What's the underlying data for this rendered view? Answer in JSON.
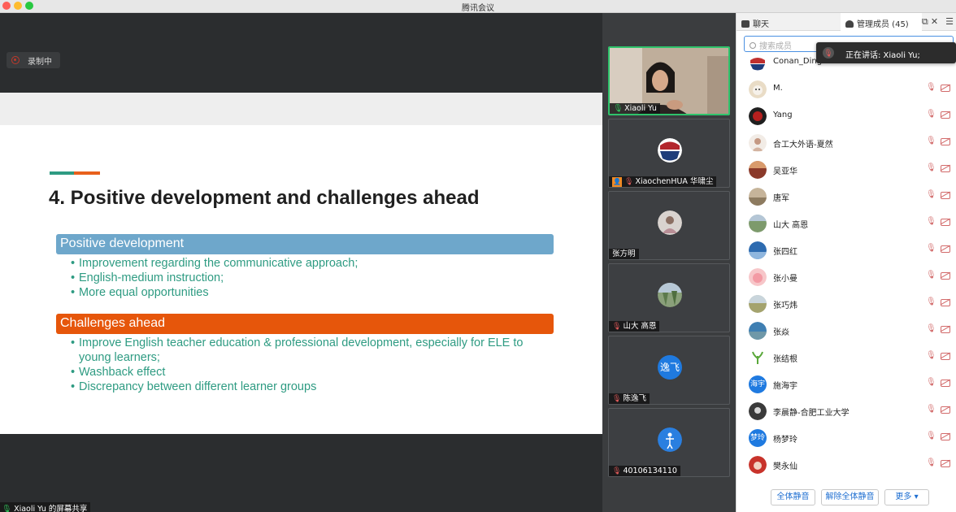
{
  "window": {
    "title": "腾讯会议"
  },
  "recording": {
    "label": "录制中"
  },
  "slide": {
    "title": "4. Positive development and challenges ahead",
    "sections": [
      {
        "heading": "Positive development",
        "color": "#6ea7cb",
        "bullets": [
          "Improvement regarding the communicative approach;",
          "English-medium instruction;",
          "More equal opportunities"
        ]
      },
      {
        "heading": "Challenges ahead",
        "color": "#e6560b",
        "bullets": [
          "Improve English teacher education & professional development, especially for ELE to young learners;",
          "Washback effect",
          "Discrepancy between different learner groups"
        ]
      }
    ]
  },
  "share_label": "Xiaoli Yu 的屏幕共享",
  "video_tiles": [
    {
      "name": "Xiaoli Yu",
      "state": "speaking"
    },
    {
      "name": "XiaochenHUA 华啸尘",
      "state": "muted"
    },
    {
      "name": "张方明",
      "state": "none"
    },
    {
      "name": "山大 高恩",
      "state": "muted"
    },
    {
      "name": "陈逸飞",
      "state": "muted",
      "avatar_text": "逸飞"
    },
    {
      "name": "40106134110",
      "state": "muted"
    }
  ],
  "panel": {
    "tab_chat": "聊天",
    "tab_members": "管理成员 (45)",
    "search_placeholder": "搜索成员",
    "speaking_banner": "正在讲话: Xiaoli Yu;",
    "members": [
      {
        "name": "Conan_Ding"
      },
      {
        "name": "M."
      },
      {
        "name": "Yang"
      },
      {
        "name": "合工大外语-夏然"
      },
      {
        "name": "吴亚华"
      },
      {
        "name": "唐军"
      },
      {
        "name": "山大 高恩"
      },
      {
        "name": "张四红"
      },
      {
        "name": "张小曼"
      },
      {
        "name": "张巧炜"
      },
      {
        "name": "张焱"
      },
      {
        "name": "张结根"
      },
      {
        "name": "施海宇",
        "avatar_text": "海宇"
      },
      {
        "name": "李晨静-合肥工业大学"
      },
      {
        "name": "杨梦玲",
        "avatar_text": "梦玲"
      },
      {
        "name": "樊永仙"
      }
    ],
    "buttons": {
      "mute_all": "全体静音",
      "unmute_all": "解除全体静音",
      "more": "更多 ▾"
    }
  }
}
